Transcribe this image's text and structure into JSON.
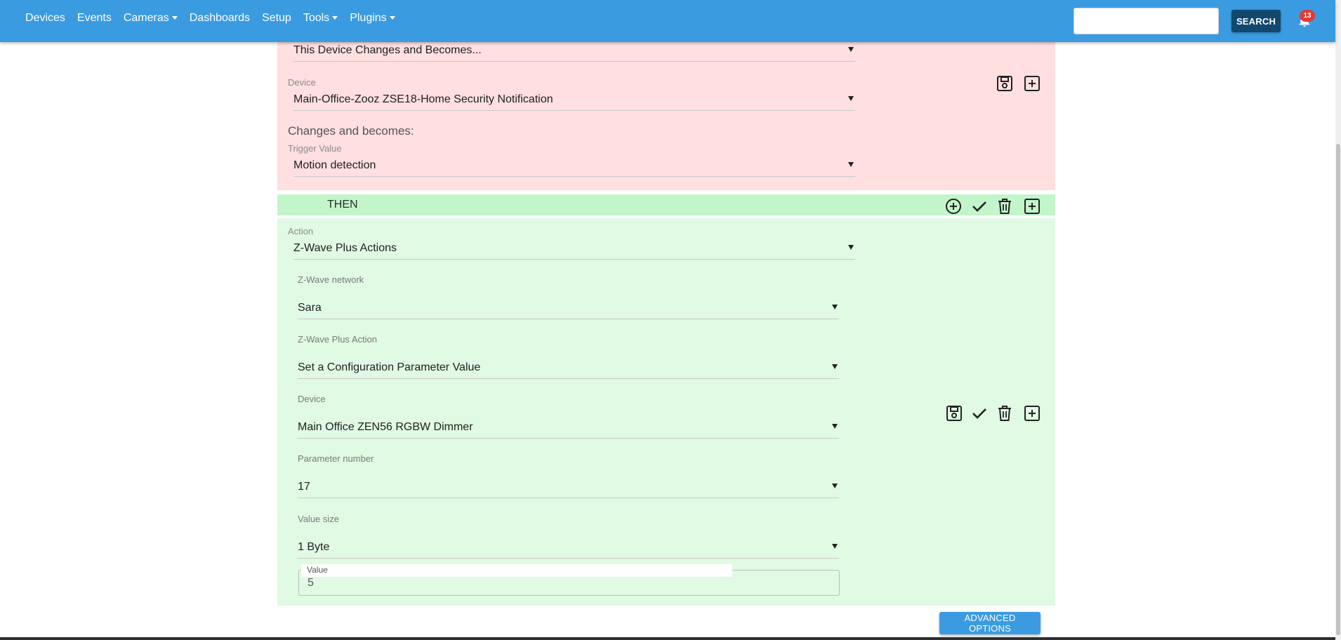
{
  "nav": {
    "items": [
      {
        "label": "Devices",
        "dropdown": false
      },
      {
        "label": "Events",
        "dropdown": false
      },
      {
        "label": "Cameras",
        "dropdown": true
      },
      {
        "label": "Dashboards",
        "dropdown": false
      },
      {
        "label": "Setup",
        "dropdown": false
      },
      {
        "label": "Tools",
        "dropdown": true
      },
      {
        "label": "Plugins",
        "dropdown": true
      }
    ],
    "search_value": "",
    "search_label": "SEARCH",
    "notification_count": "13"
  },
  "if_block": {
    "trigger_type": "This Device Changes and Becomes...",
    "device_label": "Device",
    "device_value": "Main-Office-Zooz ZSE18-Home Security Notification",
    "changes_text": "Changes and becomes:",
    "trigger_value_label": "Trigger Value",
    "trigger_value": "Motion detection"
  },
  "then_block": {
    "header": "THEN",
    "action_label": "Action",
    "action_value": "Z-Wave Plus Actions",
    "network_label": "Z-Wave network",
    "network_value": "Sara",
    "zw_action_label": "Z-Wave Plus Action",
    "zw_action_value": "Set a Configuration Parameter Value",
    "device_label": "Device",
    "device_value": "Main Office ZEN56 RGBW Dimmer",
    "param_label": "Parameter number",
    "param_value": "17",
    "size_label": "Value size",
    "size_value": "1 Byte",
    "value_label": "Value",
    "value_value": "5"
  },
  "advanced_options_label": "ADVANCED OPTIONS",
  "colors": {
    "nav": "#3a9be1",
    "search_button": "#13486e",
    "if_panel": "#ffdfe0",
    "then_bar": "#c3f5cb",
    "then_panel": "#e0fae3",
    "badge": "#e53935"
  },
  "icons": {
    "save": "floppy-disk-icon",
    "add_box": "plus-square-icon",
    "add_circle": "plus-circle-icon",
    "check": "check-icon",
    "delete": "trash-icon",
    "notifications": "bell-icon"
  }
}
